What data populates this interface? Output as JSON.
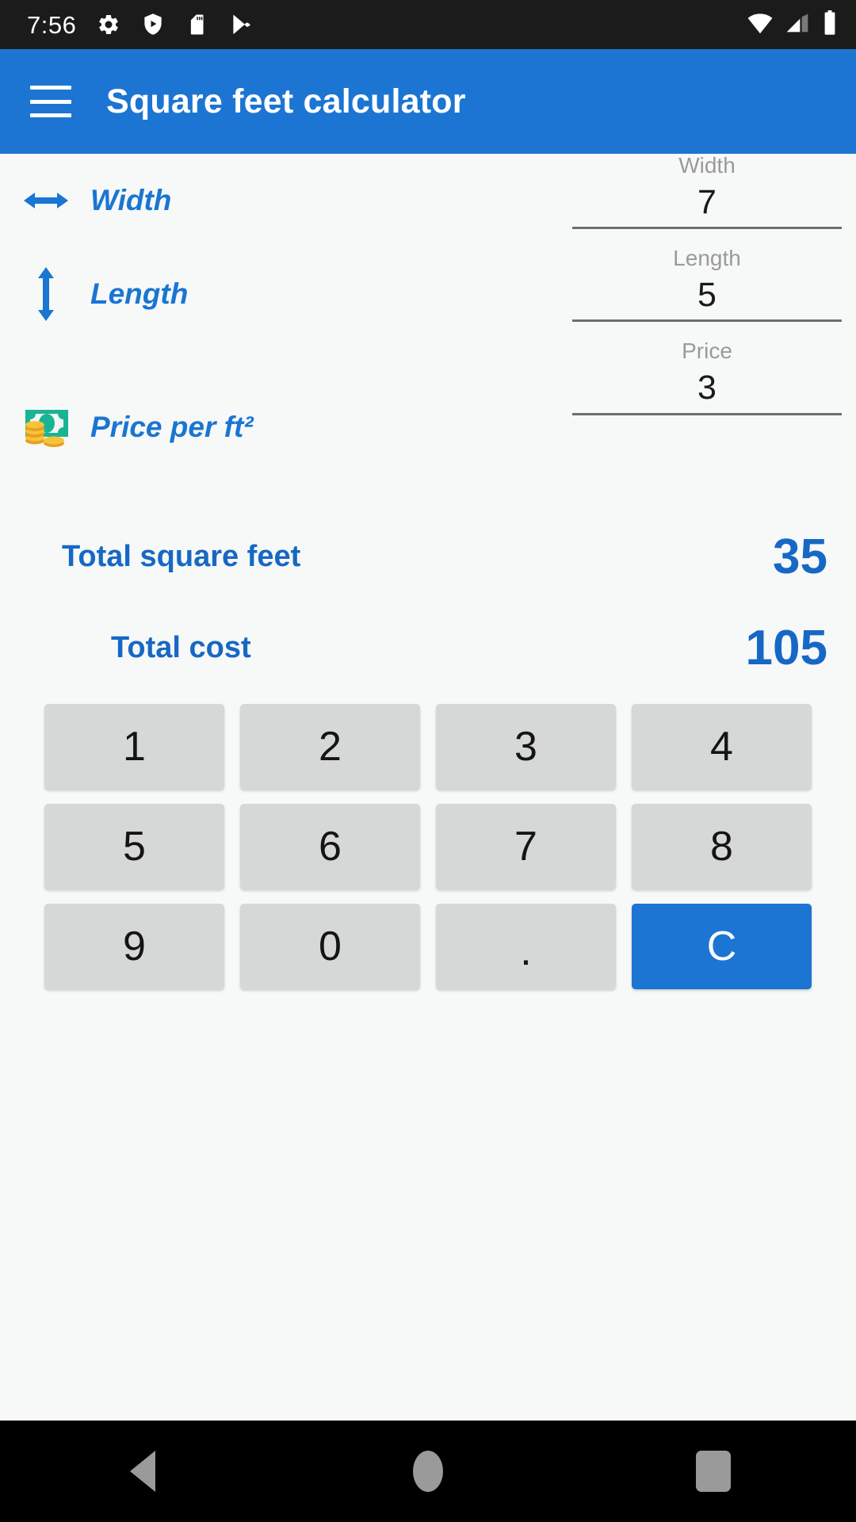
{
  "status_bar": {
    "time": "7:56",
    "left_icons": [
      "gear-icon",
      "play-protect-shield-icon",
      "sd-card-icon",
      "play-store-icon"
    ],
    "right_icons": [
      "wifi-icon",
      "cellular-signal-icon",
      "battery-icon"
    ],
    "background_color": "#1B1B1B"
  },
  "app_bar": {
    "menu_icon": "hamburger-menu-icon",
    "title": "Square feet calculator",
    "background_color": "#1C75D2",
    "text_color": "#FFFFFF"
  },
  "form": {
    "rows": [
      {
        "icon": "horizontal-double-arrow-icon",
        "label": "Width"
      },
      {
        "icon": "vertical-double-arrow-icon",
        "label": "Length"
      },
      {
        "icon": "money-banknote-coins-icon",
        "label": "Price per ft²"
      }
    ],
    "fields": [
      {
        "label": "Width",
        "value": "7",
        "placeholder": "Width"
      },
      {
        "label": "Length",
        "value": "5",
        "placeholder": "Length"
      },
      {
        "label": "Price",
        "value": "3",
        "placeholder": "Price"
      }
    ]
  },
  "results": [
    {
      "label": "Total square feet",
      "value": "35"
    },
    {
      "label": "Total cost",
      "value": "105"
    }
  ],
  "keypad": {
    "rows": [
      [
        "1",
        "2",
        "3",
        "4"
      ],
      [
        "5",
        "6",
        "7",
        "8"
      ],
      [
        "9",
        "0",
        ".",
        "C"
      ]
    ],
    "clear_key": "C",
    "key_background": "#D6D7D7",
    "clear_background": "#1C75D2"
  },
  "nav_bar": {
    "buttons": [
      "back-button",
      "home-button",
      "recents-button"
    ],
    "background_color": "#000000"
  },
  "colors": {
    "accent_blue": "#1C75D2",
    "label_blue": "#1976D2",
    "result_blue": "#1668C4",
    "page_background": "#F7F8F8",
    "field_hint": "#9A9A9A"
  }
}
